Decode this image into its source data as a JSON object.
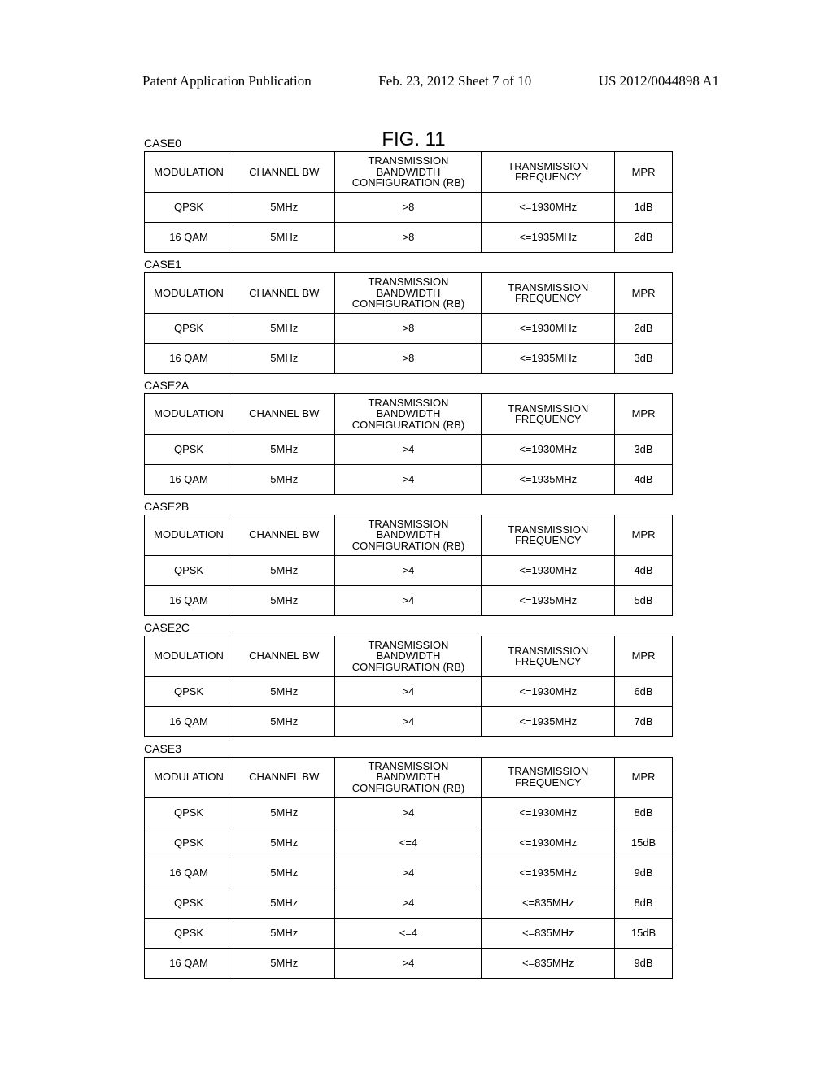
{
  "header": {
    "left": "Patent Application Publication",
    "center": "Feb. 23, 2012   Sheet 7 of 10",
    "right": "US 2012/0044898 A1"
  },
  "figure_title": "FIG. 11",
  "columns": {
    "modulation": "MODULATION",
    "channel_bw": "CHANNEL BW",
    "tx_bw_config": "TRANSMISSION BANDWIDTH CONFIGURATION (RB)",
    "tx_freq": "TRANSMISSION FREQUENCY",
    "mpr": "MPR"
  },
  "cases": [
    {
      "label": "CASE0",
      "rows": [
        {
          "mod": "QPSK",
          "bw": "5MHz",
          "rb": ">8",
          "freq": "<=1930MHz",
          "mpr": "1dB"
        },
        {
          "mod": "16 QAM",
          "bw": "5MHz",
          "rb": ">8",
          "freq": "<=1935MHz",
          "mpr": "2dB"
        }
      ]
    },
    {
      "label": "CASE1",
      "rows": [
        {
          "mod": "QPSK",
          "bw": "5MHz",
          "rb": ">8",
          "freq": "<=1930MHz",
          "mpr": "2dB"
        },
        {
          "mod": "16 QAM",
          "bw": "5MHz",
          "rb": ">8",
          "freq": "<=1935MHz",
          "mpr": "3dB"
        }
      ]
    },
    {
      "label": "CASE2A",
      "rows": [
        {
          "mod": "QPSK",
          "bw": "5MHz",
          "rb": ">4",
          "freq": "<=1930MHz",
          "mpr": "3dB"
        },
        {
          "mod": "16 QAM",
          "bw": "5MHz",
          "rb": ">4",
          "freq": "<=1935MHz",
          "mpr": "4dB"
        }
      ]
    },
    {
      "label": "CASE2B",
      "rows": [
        {
          "mod": "QPSK",
          "bw": "5MHz",
          "rb": ">4",
          "freq": "<=1930MHz",
          "mpr": "4dB"
        },
        {
          "mod": "16 QAM",
          "bw": "5MHz",
          "rb": ">4",
          "freq": "<=1935MHz",
          "mpr": "5dB"
        }
      ]
    },
    {
      "label": "CASE2C",
      "rows": [
        {
          "mod": "QPSK",
          "bw": "5MHz",
          "rb": ">4",
          "freq": "<=1930MHz",
          "mpr": "6dB"
        },
        {
          "mod": "16 QAM",
          "bw": "5MHz",
          "rb": ">4",
          "freq": "<=1935MHz",
          "mpr": "7dB"
        }
      ]
    },
    {
      "label": "CASE3",
      "rows": [
        {
          "mod": "QPSK",
          "bw": "5MHz",
          "rb": ">4",
          "freq": "<=1930MHz",
          "mpr": "8dB"
        },
        {
          "mod": "QPSK",
          "bw": "5MHz",
          "rb": "<=4",
          "freq": "<=1930MHz",
          "mpr": "15dB"
        },
        {
          "mod": "16 QAM",
          "bw": "5MHz",
          "rb": ">4",
          "freq": "<=1935MHz",
          "mpr": "9dB"
        },
        {
          "mod": "QPSK",
          "bw": "5MHz",
          "rb": ">4",
          "freq": "<=835MHz",
          "mpr": "8dB"
        },
        {
          "mod": "QPSK",
          "bw": "5MHz",
          "rb": "<=4",
          "freq": "<=835MHz",
          "mpr": "15dB"
        },
        {
          "mod": "16 QAM",
          "bw": "5MHz",
          "rb": ">4",
          "freq": "<=835MHz",
          "mpr": "9dB"
        }
      ]
    }
  ]
}
